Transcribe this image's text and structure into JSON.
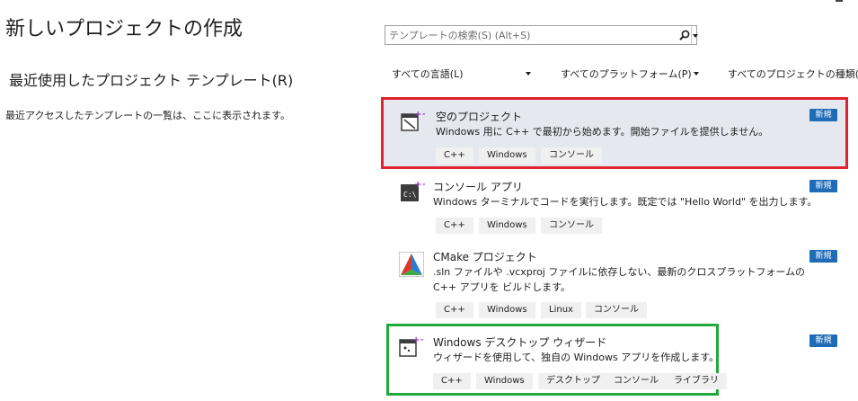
{
  "page": {
    "title": "新しいプロジェクトの作成",
    "recent_title": "最近使用したプロジェクト テンプレート(R)",
    "recent_empty": "最近アクセスしたテンプレートの一覧は、ここに表示されます。"
  },
  "search": {
    "placeholder": "テンプレートの検索(S) (Alt+S)",
    "search_icon": "search-icon",
    "dropdown_icon": "chevron-down-icon"
  },
  "filters": [
    {
      "label": "すべての言語(L)"
    },
    {
      "label": "すべてのプラットフォーム(P)"
    },
    {
      "label": "すべてのプロジェクトの種類("
    }
  ],
  "templates": [
    {
      "name": "空のプロジェクト",
      "description": "Windows 用に C++ で最初から始めます。開始ファイルを提供しません。",
      "badge": "新規",
      "tags": [
        "C++",
        "Windows",
        "コンソール"
      ],
      "icon": "empty-project-icon"
    },
    {
      "name": "コンソール アプリ",
      "description": "Windows ターミナルでコードを実行します。既定では \"Hello World\" を出力します。",
      "badge": "新規",
      "tags": [
        "C++",
        "Windows",
        "コンソール"
      ],
      "icon": "console-app-icon"
    },
    {
      "name": "CMake プロジェクト",
      "description": ".sln ファイルや .vcxproj ファイルに依存しない、最新のクロスプラットフォームの C++ アプリを ビルドします。",
      "badge": "新規",
      "tags": [
        "C++",
        "Windows",
        "Linux",
        "コンソール"
      ],
      "icon": "cmake-icon"
    },
    {
      "name": "Windows デスクトップ ウィザード",
      "description": "ウィザードを使用して、独自の Windows アプリを作成します。",
      "badge": "新規",
      "tags": [
        "C++",
        "Windows",
        "デスクトップ",
        "コンソール",
        "ライブラリ"
      ],
      "icon": "desktop-wizard-icon"
    }
  ],
  "colors": {
    "accent_badge": "#1e6cb6",
    "selected_bg": "#e6e8ef",
    "highlight_red": "#e0232c",
    "highlight_green": "#22a83b",
    "cpp_plus": "#8a3bb3"
  }
}
